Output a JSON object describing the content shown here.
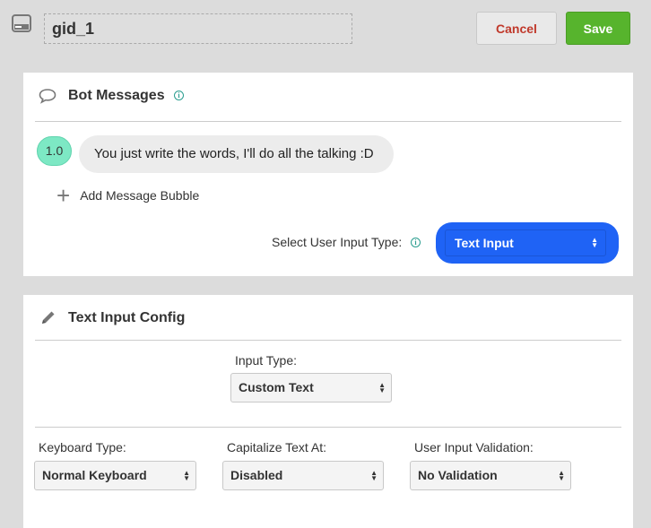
{
  "topbar": {
    "block_icon": "message-block-icon",
    "block_name": "gid_1",
    "cancel_label": "Cancel",
    "save_label": "Save"
  },
  "bot_messages": {
    "title": "Bot Messages",
    "icon": "speech-bubble-icon",
    "messages": [
      {
        "index": "1.0",
        "text": "You just write the words, I'll do all the talking :D"
      }
    ],
    "add_label": "Add Message Bubble",
    "input_type_label": "Select User Input Type:",
    "input_type_value": "Text Input"
  },
  "text_input_config": {
    "title": "Text Input Config",
    "icon": "pencil-icon",
    "input_type": {
      "label": "Input Type:",
      "value": "Custom Text"
    },
    "keyboard_type": {
      "label": "Keyboard Type:",
      "value": "Normal Keyboard"
    },
    "capitalize": {
      "label": "Capitalize Text At:",
      "value": "Disabled"
    },
    "validation": {
      "label": "User Input Validation:",
      "value": "No Validation"
    }
  },
  "colors": {
    "save": "#57b42d",
    "cancel_text": "#c0392b",
    "input_type_select": "#1f63f5",
    "badge": "#7de8c4"
  }
}
